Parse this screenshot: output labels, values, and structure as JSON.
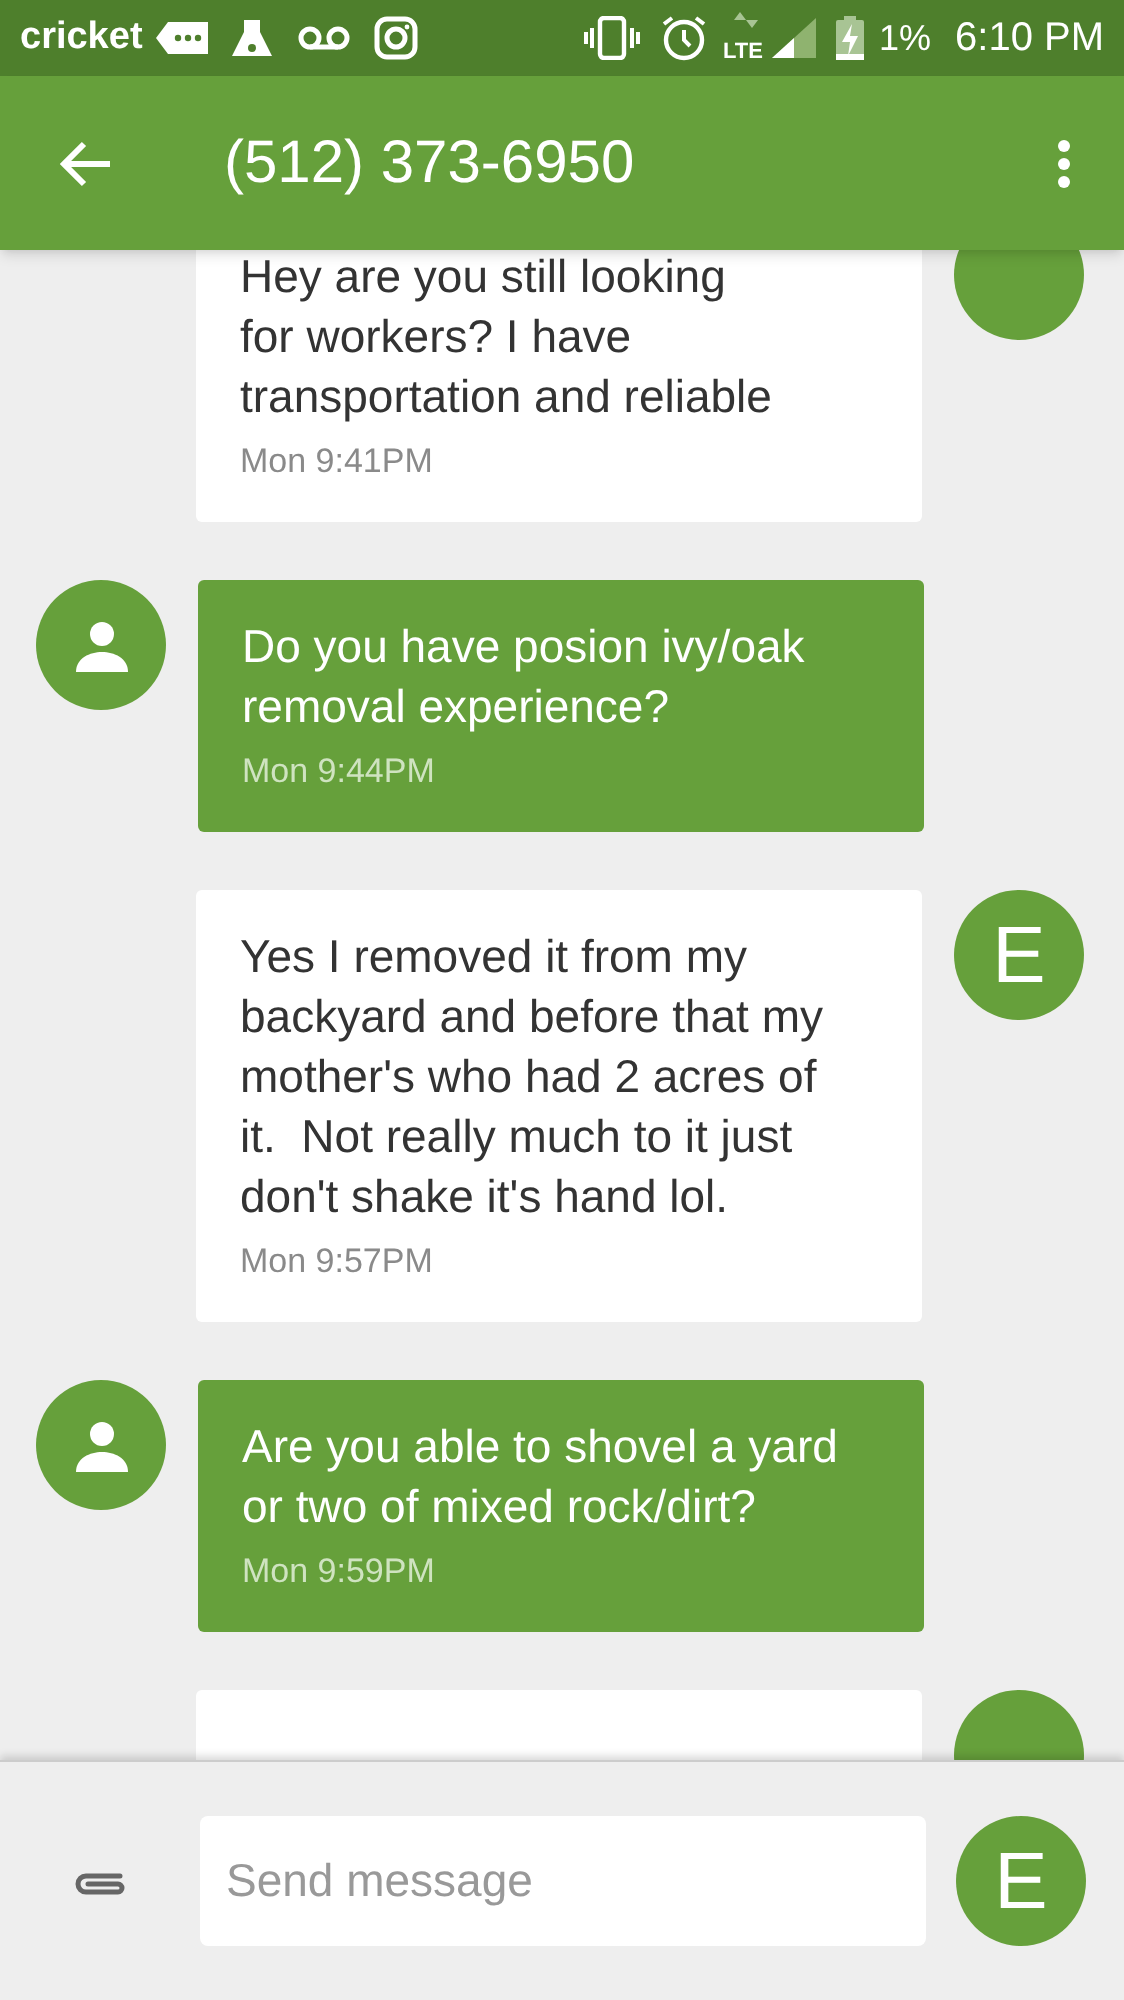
{
  "status_bar": {
    "carrier": "cricket",
    "network": "LTE",
    "battery": "1%",
    "time": "6:10 PM"
  },
  "toolbar": {
    "title": "(512) 373-6950"
  },
  "messages": [
    {
      "kind": "incoming",
      "text": "Hey are you still looking\nfor workers? I have\ntransportation and reliable",
      "time": "Mon 9:41PM"
    },
    {
      "kind": "outgoing",
      "text": "Do you have posion ivy/oak\nremoval experience?",
      "time": "Mon 9:44PM"
    },
    {
      "kind": "incoming",
      "avatar": "E",
      "text": "Yes I removed it from my\nbackyard and before that my\nmother's who had 2 acres of\nit.  Not really much to it just\ndon't shake it's hand lol.",
      "time": "Mon 9:57PM"
    },
    {
      "kind": "outgoing",
      "text": "Are you able to shovel a yard\nor two of mixed rock/dirt?",
      "time": "Mon 9:59PM"
    },
    {
      "kind": "incoming"
    }
  ],
  "composer": {
    "placeholder": "Send message",
    "avatar": "E"
  }
}
